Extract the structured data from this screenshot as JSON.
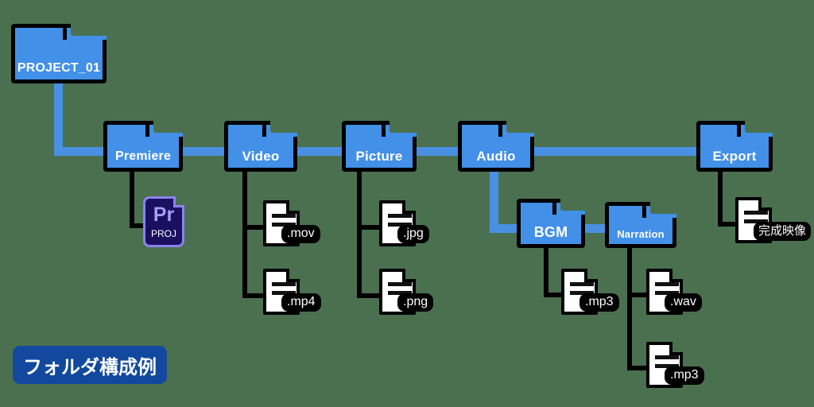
{
  "diagram": {
    "caption": "フォルダ構成例",
    "colors": {
      "background": "#4a7050",
      "folder": "#4290e8",
      "connector_blue": "#4a90e2",
      "connector_black": "#000000",
      "caption_badge": "#12499e",
      "premiere_fill": "#1b0f60",
      "premiere_accent": "#8d82f0",
      "premiere_text": "#a79df5"
    },
    "root": {
      "label": "PROJECT_01"
    },
    "folders": [
      {
        "label": "Premiere"
      },
      {
        "label": "Video"
      },
      {
        "label": "Picture"
      },
      {
        "label": "Audio"
      },
      {
        "label": "Export"
      },
      {
        "label": "BGM"
      },
      {
        "label": "Narration"
      }
    ],
    "files": {
      "premiere_project": {
        "app": "Pr",
        "type": "PROJ"
      },
      "video": [
        {
          "label": ".mov"
        },
        {
          "label": ".mp4"
        }
      ],
      "picture": [
        {
          "label": ".jpg"
        },
        {
          "label": ".png"
        }
      ],
      "bgm": [
        {
          "label": ".mp3"
        }
      ],
      "narration": [
        {
          "label": ".wav"
        },
        {
          "label": ".mp3"
        }
      ],
      "export": [
        {
          "label": "完成映像"
        }
      ]
    }
  }
}
